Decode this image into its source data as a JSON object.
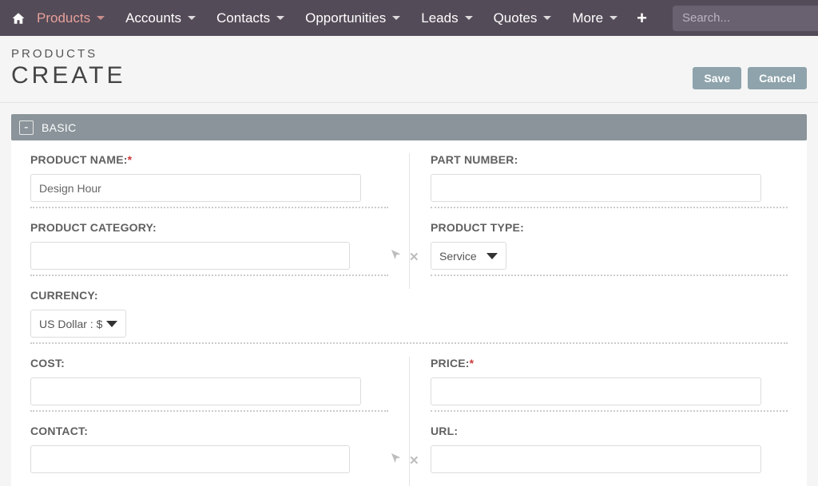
{
  "nav": {
    "items": [
      {
        "label": "Products",
        "active": true
      },
      {
        "label": "Accounts"
      },
      {
        "label": "Contacts"
      },
      {
        "label": "Opportunities"
      },
      {
        "label": "Leads"
      },
      {
        "label": "Quotes"
      },
      {
        "label": "More"
      }
    ],
    "search_placeholder": "Search..."
  },
  "page": {
    "breadcrumb": "PRODUCTS",
    "title": "CREATE",
    "save": "Save",
    "cancel": "Cancel"
  },
  "panel": {
    "title": "BASIC",
    "collapse_symbol": "-"
  },
  "fields": {
    "product_name": {
      "label": "PRODUCT NAME:",
      "value": "Design Hour",
      "required": true
    },
    "part_number": {
      "label": "PART NUMBER:",
      "value": ""
    },
    "product_category": {
      "label": "PRODUCT CATEGORY:",
      "value": ""
    },
    "product_type": {
      "label": "PRODUCT TYPE:",
      "value": "Service"
    },
    "currency": {
      "label": "CURRENCY:",
      "value": "US Dollar : $"
    },
    "cost": {
      "label": "COST:",
      "value": ""
    },
    "price": {
      "label": "PRICE:",
      "value": "",
      "required": true
    },
    "contact": {
      "label": "CONTACT:",
      "value": ""
    },
    "url": {
      "label": "URL:",
      "value": ""
    }
  },
  "colors": {
    "navbar_bg": "#544b58",
    "active_nav": "#e6a09a",
    "panel_header": "#8a949a",
    "button_bg": "#8ea3ab"
  }
}
